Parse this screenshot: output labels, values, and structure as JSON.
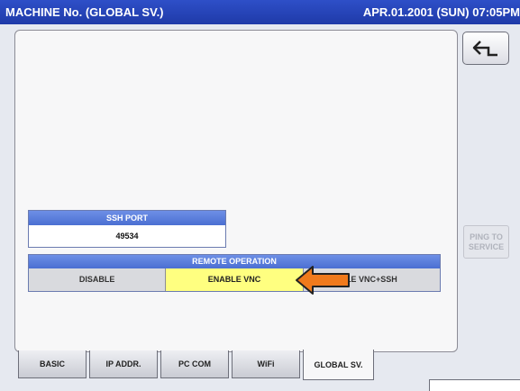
{
  "header": {
    "title": "MACHINE No. (GLOBAL SV.)",
    "clock": "APR.01.2001 (SUN) 07:05PM"
  },
  "buttons": {
    "back_icon": "return-arrow-icon",
    "ping": "PING TO SERVICE"
  },
  "ssh": {
    "label": "SSH PORT",
    "value": "49534"
  },
  "remote": {
    "label": "REMOTE OPERATION",
    "options": [
      "DISABLE",
      "ENABLE VNC",
      "LE VNC+SSH"
    ],
    "selected": "ENABLE VNC"
  },
  "tabs": [
    {
      "label": "BASIC"
    },
    {
      "label": "IP ADDR."
    },
    {
      "label": "PC COM"
    },
    {
      "label": "WiFi"
    },
    {
      "label": "GLOBAL SV."
    }
  ],
  "active_tab": "GLOBAL SV.",
  "colors": {
    "titlebar": "#2445c0",
    "header_blue": "#5a7ddc",
    "selected": "#ffff80",
    "arrow": "#f07a1c"
  }
}
